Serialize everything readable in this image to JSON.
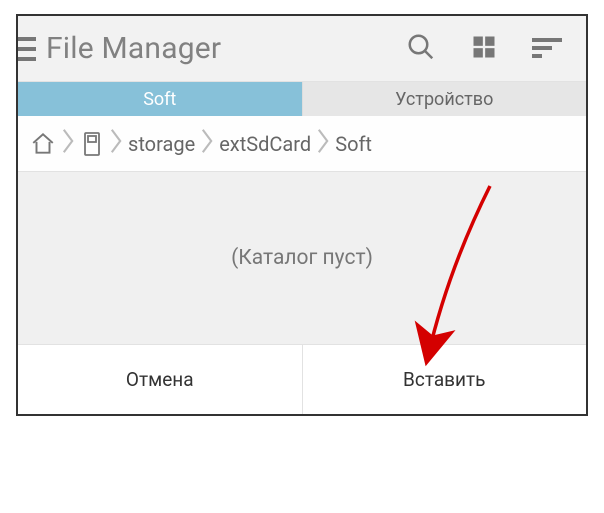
{
  "header": {
    "title": "File Manager"
  },
  "tabs": [
    {
      "label": "Soft",
      "active": true
    },
    {
      "label": "Устройство",
      "active": false
    }
  ],
  "breadcrumb": [
    "storage",
    "extSdCard",
    "Soft"
  ],
  "content": {
    "empty_message": "(Каталог пуст)"
  },
  "footer": {
    "cancel": "Отмена",
    "paste": "Вставить"
  }
}
